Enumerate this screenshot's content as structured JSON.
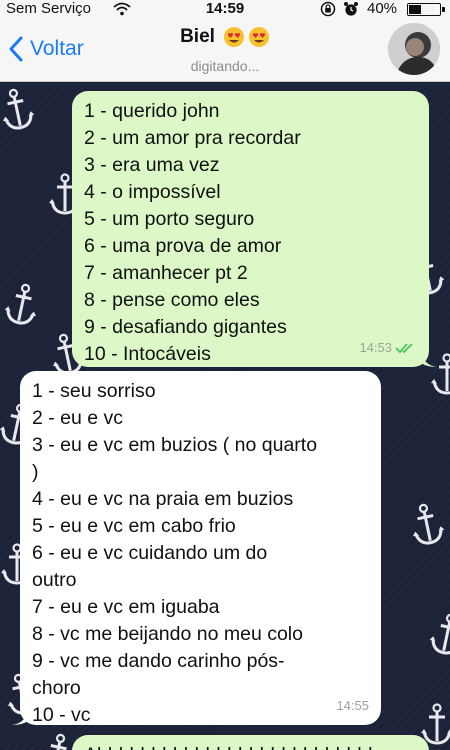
{
  "status_bar": {
    "carrier": "Sem Serviço",
    "time": "14:59",
    "battery": "40%",
    "battery_level": 0.4,
    "icons": [
      "wifi-icon",
      "rotation-lock-icon",
      "alarm-icon",
      "battery-icon"
    ]
  },
  "header": {
    "back_label": "Voltar",
    "contact_name": "Biel",
    "name_emojis": [
      "heart-eyes-emoji",
      "heart-eyes-emoji"
    ],
    "status": "digitando..."
  },
  "colors": {
    "accent": "#1a7cf5",
    "outgoing_bubble": "#dcf8c6",
    "incoming_bubble": "#ffffff",
    "wallpaper": "#1c2238",
    "read_ticks": "#4fc35b"
  },
  "messages": [
    {
      "direction": "outgoing",
      "lines": [
        "1 - querido john",
        "2 - um amor pra recordar",
        "3 - era uma vez",
        "4 - o impossível",
        "5 - um porto seguro",
        "6 - uma prova de amor",
        "7 - amanhecer pt 2",
        "8 - pense como eles",
        "9 - desafiando gigantes",
        "10 - Intocáveis"
      ],
      "time": "14:53",
      "status": "read"
    },
    {
      "direction": "incoming",
      "lines": [
        "1 - seu sorriso",
        "2 - eu e vc",
        "3 - eu e vc em buzios ( no quarto",
        ")",
        "4 - eu e vc na praia em buzios",
        "5 - eu e vc em cabo frio",
        "6 - eu e vc cuidando um do",
        "outro",
        "7 - eu e vc em iguaba",
        "8 - vc me beijando no meu colo",
        "9 - vc me dando carinho pós-",
        "choro",
        "10 - vc"
      ],
      "time": "14:55"
    },
    {
      "direction": "outgoing",
      "lines": [
        "Ahhhhhhhhhhhhhhhhhhhhhhhhhh"
      ]
    }
  ]
}
